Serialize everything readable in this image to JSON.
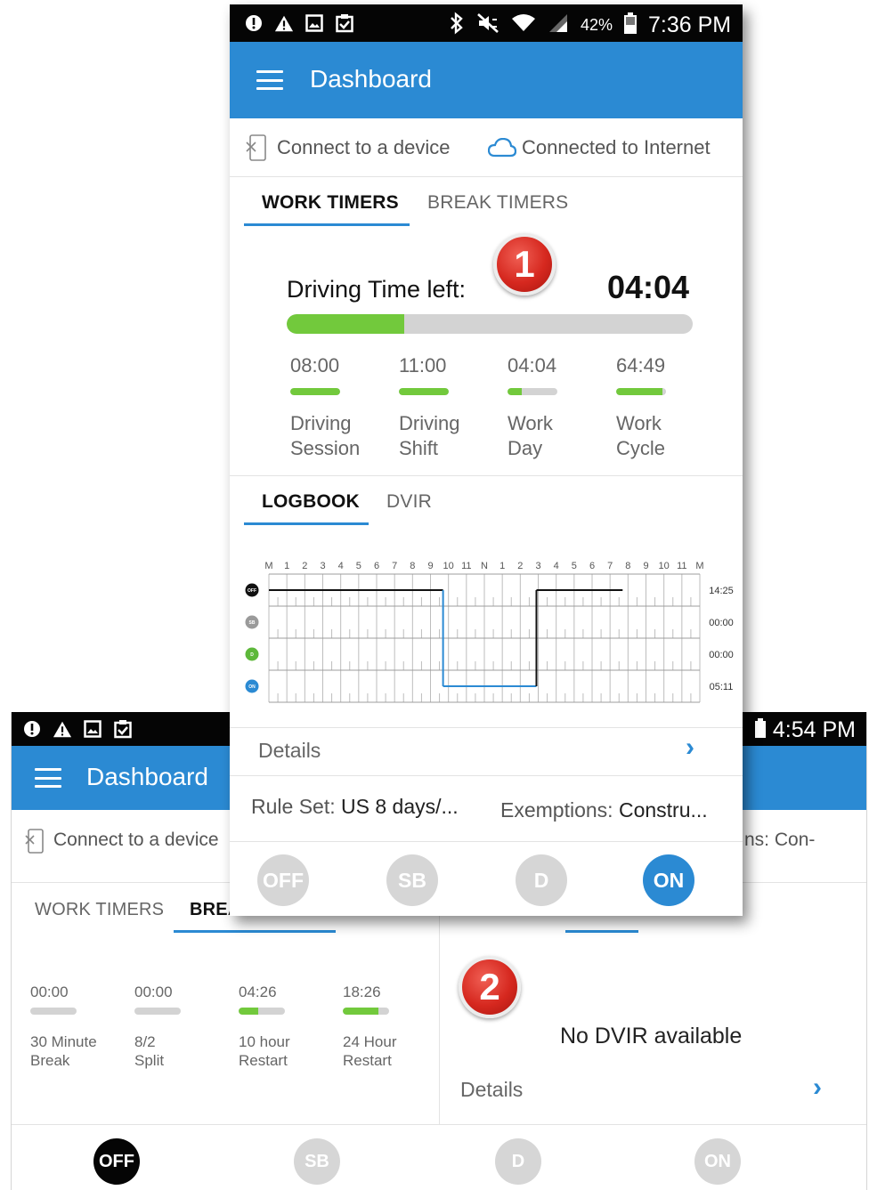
{
  "colors": {
    "accent": "#2b8ad3",
    "progress_green": "#72c93c",
    "track_grey": "#d3d3d3",
    "badge_red": "#d6281f",
    "status_black": "#050505"
  },
  "front": {
    "status_bar": {
      "battery": "42%",
      "time": "7:36 PM",
      "left_icons": [
        "alert-circle-icon",
        "warning-icon",
        "image-icon",
        "clipboard-icon"
      ],
      "right_icons": [
        "bluetooth-icon",
        "mute-icon",
        "wifi-icon",
        "signal-icon",
        "battery-icon"
      ]
    },
    "app_bar": {
      "title": "Dashboard"
    },
    "connection": {
      "device": "Connect to a device",
      "internet": "Connected to Internet"
    },
    "timer_tabs": [
      "WORK TIMERS",
      "BREAK TIMERS"
    ],
    "badge": "1",
    "driving_time": {
      "label": "Driving Time left:",
      "value": "04:04",
      "progress": 0.29
    },
    "timers": [
      {
        "value": "08:00",
        "progress": 1.0,
        "label_line1": "Driving",
        "label_line2": "Session"
      },
      {
        "value": "11:00",
        "progress": 1.0,
        "label_line1": "Driving",
        "label_line2": "Shift"
      },
      {
        "value": "04:04",
        "progress": 0.29,
        "label_line1": "Work",
        "label_line2": "Day"
      },
      {
        "value": "64:49",
        "progress": 0.93,
        "label_line1": "Work",
        "label_line2": "Cycle"
      }
    ],
    "log_tabs": [
      "LOGBOOK",
      "DVIR"
    ],
    "logbook": {
      "hour_labels": [
        "M",
        "1",
        "2",
        "3",
        "4",
        "5",
        "6",
        "7",
        "8",
        "9",
        "10",
        "11",
        "N",
        "1",
        "2",
        "3",
        "4",
        "5",
        "6",
        "7",
        "8",
        "9",
        "10",
        "11",
        "M"
      ],
      "rows": [
        {
          "status": "OFF",
          "total": "14:25",
          "color": "#111111"
        },
        {
          "status": "SB",
          "total": "00:00",
          "color": "#9a9a9a"
        },
        {
          "status": "D",
          "total": "00:00",
          "color": "#5db83a"
        },
        {
          "status": "ON",
          "total": "05:11",
          "color": "#2b8ad3"
        }
      ],
      "segments": [
        {
          "status": "OFF",
          "start": 0,
          "end": 9.7
        },
        {
          "status": "ON",
          "start": 9.7,
          "end": 14.9
        },
        {
          "status": "OFF",
          "start": 14.9,
          "end": 19.7
        }
      ]
    },
    "details_label": "Details",
    "rule_set": {
      "label": "Rule Set:",
      "value": "US 8 days/..."
    },
    "exemptions": {
      "label": "Exemptions:",
      "value": "Constru..."
    },
    "status_buttons": [
      {
        "label": "OFF",
        "active": false
      },
      {
        "label": "SB",
        "active": false
      },
      {
        "label": "D",
        "active": false
      },
      {
        "label": "ON",
        "active": true
      }
    ]
  },
  "back": {
    "status_bar": {
      "time": "4:54 PM",
      "left_icons": [
        "alert-circle-icon",
        "warning-icon",
        "image-icon",
        "clipboard-icon"
      ]
    },
    "app_bar": {
      "title": "Dashboard"
    },
    "connection": {
      "device": "Connect to a device",
      "exemptions_fragment": "ns:  Con-"
    },
    "timer_tabs": [
      "WORK TIMERS",
      "BREA"
    ],
    "timers": [
      {
        "value": "00:00",
        "progress": 0.0,
        "label_line1": "30 Minute",
        "label_line2": "Break"
      },
      {
        "value": "00:00",
        "progress": 0.0,
        "label_line1": "8/2",
        "label_line2": "Split"
      },
      {
        "value": "04:26",
        "progress": 0.42,
        "label_line1": "10 hour",
        "label_line2": "Restart"
      },
      {
        "value": "18:26",
        "progress": 0.77,
        "label_line1": "24 Hour",
        "label_line2": "Restart"
      }
    ],
    "badge": "2",
    "no_dvir": "No DVIR available",
    "details_label": "Details",
    "status_buttons": [
      {
        "label": "OFF",
        "active": true
      },
      {
        "label": "SB",
        "active": false
      },
      {
        "label": "D",
        "active": false
      },
      {
        "label": "ON",
        "active": false
      }
    ]
  }
}
